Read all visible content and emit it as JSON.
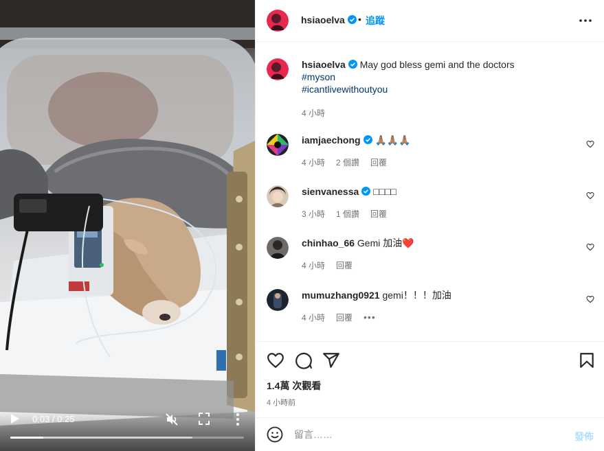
{
  "video": {
    "time_display": "0:03 / 0:25",
    "played_fraction": 0.14,
    "buffered_fraction": 0.78,
    "muted": true
  },
  "post_header": {
    "username": "hsiaoelva",
    "separator": "•",
    "follow_label": "追蹤"
  },
  "caption": {
    "username": "hsiaoelva",
    "text": "May god bless gemi and the doctors",
    "hashtags": [
      "#myson",
      "#icantlivewithoutyou"
    ],
    "time": "4 小時"
  },
  "comments": [
    {
      "username": "iamjaechong",
      "verified": true,
      "text": "🙏🏽🙏🏽🙏🏽",
      "time": "4 小時",
      "likes": "2 個讚",
      "reply": "回覆",
      "show_more": false
    },
    {
      "username": "sienvanessa",
      "verified": true,
      "text": "□□□□",
      "time": "3 小時",
      "likes": "1 個讚",
      "reply": "回覆",
      "show_more": false
    },
    {
      "username": "chinhao_66",
      "verified": false,
      "text": "Gemi 加油❤️",
      "time": "4 小時",
      "likes": "",
      "reply": "回覆",
      "show_more": false
    },
    {
      "username": "mumuzhang0921",
      "verified": false,
      "text": "gemi！！！加油",
      "time": "4 小時",
      "likes": "",
      "reply": "回覆",
      "show_more": true,
      "more_label": "•••"
    }
  ],
  "stats": {
    "views": "1.4萬 次觀看",
    "posted": "4 小時前"
  },
  "composer": {
    "placeholder": "留言……",
    "post_label": "發佈"
  },
  "colors": {
    "accent": "#0095f6",
    "verified": "#0095f6",
    "hashtag": "#00376b",
    "muted_text": "#737373",
    "post_disabled": "#b2dffc",
    "border": "#efefef"
  },
  "icons": {
    "video": [
      "play-icon",
      "mute-icon",
      "fullscreen-icon",
      "more-vertical-icon"
    ],
    "actions": [
      "heart-icon",
      "comment-icon",
      "share-icon",
      "bookmark-icon"
    ],
    "composer": [
      "emoji-icon"
    ],
    "header": [
      "more-horizontal-icon",
      "verified-badge-icon"
    ]
  }
}
